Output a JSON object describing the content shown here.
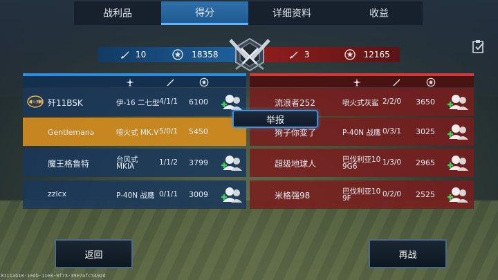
{
  "tabs": [
    {
      "label": "战利品",
      "active": false
    },
    {
      "label": "得分",
      "active": true
    },
    {
      "label": "详细资料",
      "active": false
    },
    {
      "label": "收益",
      "active": false
    }
  ],
  "summary": {
    "blue": {
      "kills": "10",
      "score": "18358"
    },
    "red": {
      "kills": "3",
      "score": "12165"
    }
  },
  "report_label": "举报",
  "blue_team": [
    {
      "name": "歼11BSK",
      "plane": "伊-16 二七型",
      "kda": "4/1/1",
      "score": "6100",
      "badge": "战斗英雄"
    },
    {
      "name": "Gentlemanঌ",
      "plane": "喷火式 MK.V",
      "kda": "5/0/1",
      "score": "5450",
      "highlight": true
    },
    {
      "name": "魔王格鲁特",
      "plane": "台风式 MKIA",
      "plane_lines": [
        "台风式",
        "MKIA"
      ],
      "kda": "1/1/2",
      "score": "3799"
    },
    {
      "name": "zzlcx",
      "plane": "P-40N 战鹰",
      "kda": "0/1/1",
      "score": "3009"
    }
  ],
  "red_team": [
    {
      "name": "流浪者252",
      "plane": "喷火式灰鲨",
      "kda": "2/2/0",
      "score": "3650"
    },
    {
      "name": "狗子你变了",
      "plane": "P-40N 战鹰",
      "kda": "0/3/1",
      "score": "3025"
    },
    {
      "name": "超级地球人",
      "plane": "巴伐利亚10 9G6",
      "plane_lines": [
        "巴伐利亚10",
        "9G6"
      ],
      "kda": "1/3/0",
      "score": "2965"
    },
    {
      "name": "米格强98",
      "plane": "巴伐利亚10 9F",
      "plane_lines": [
        "巴伐利亚10",
        "9F"
      ],
      "kda": "0/2/0",
      "score": "2525"
    }
  ],
  "buttons": {
    "back": "返回",
    "rematch": "再战"
  },
  "debug_id": "8111ab10-1edb-11e8-9f73-39e7afc5492d",
  "icons": [
    "plane-icon",
    "sword-icon",
    "medal-icon",
    "add-friend-icon",
    "clipboard-icon",
    "emblem-icon"
  ],
  "colors": {
    "blue_team": "#1d5f9a",
    "red_team": "#8f1d1d",
    "highlight": "#d28c1e",
    "accent": "#5db3ff"
  }
}
